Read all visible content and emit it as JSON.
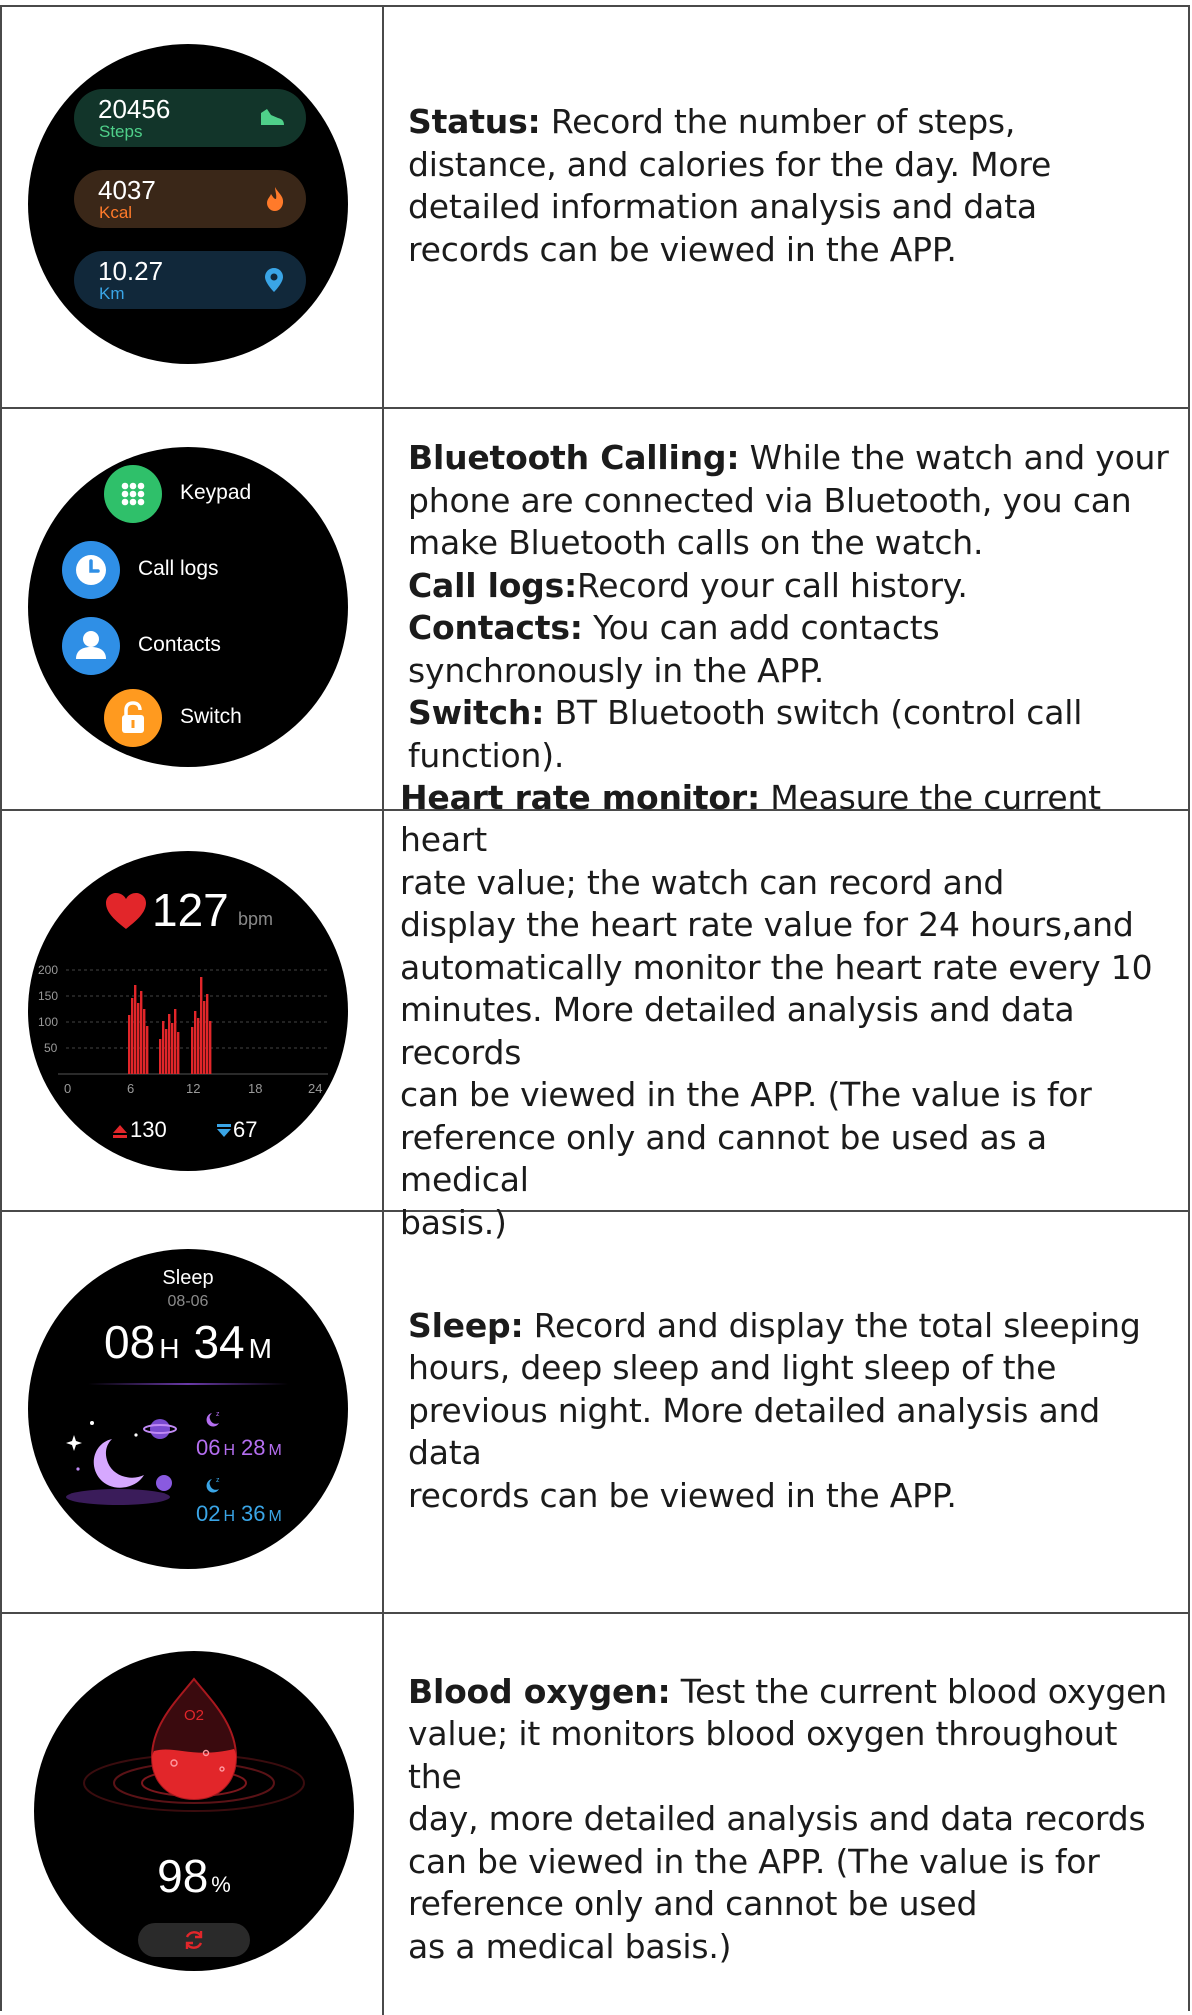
{
  "rows": [
    {
      "watch": {
        "cards": [
          {
            "value": "20456",
            "label": "Steps",
            "icon": "shoe-icon",
            "bg": "#12352a",
            "label_color": "#4fd08a",
            "icon_color": "#4fd08a"
          },
          {
            "value": "4037",
            "label": "Kcal",
            "icon": "flame-icon",
            "bg": "#3a2718",
            "label_color": "#ff7a2a",
            "icon_color": "#ff7a2a"
          },
          {
            "value": "10.27",
            "label": "Km",
            "icon": "location-pin-icon",
            "bg": "#11283a",
            "label_color": "#3aa5e6",
            "icon_color": "#3aa5e6"
          }
        ]
      },
      "desc": [
        {
          "b": "Status:",
          "t": " Record the number of steps,"
        },
        {
          "b": "",
          "t": "distance, and calories for the day. More"
        },
        {
          "b": "",
          "t": "detailed information analysis and data"
        },
        {
          "b": "",
          "t": "records can be viewed in the APP."
        }
      ]
    },
    {
      "watch": {
        "items": [
          {
            "label": "Keypad",
            "icon": "keypad-icon",
            "color": "#2fc06a"
          },
          {
            "label": "Call logs",
            "icon": "clock-icon",
            "color": "#2f8fe6"
          },
          {
            "label": "Contacts",
            "icon": "person-icon",
            "color": "#2f8fe6"
          },
          {
            "label": "Switch",
            "icon": "lock-icon",
            "color": "#ff9a1f"
          }
        ]
      },
      "desc": [
        {
          "b": "Bluetooth Calling:",
          "t": " While the watch and your"
        },
        {
          "b": "",
          "t": "phone are connected via Bluetooth, you can"
        },
        {
          "b": "",
          "t": "make Bluetooth calls on the watch."
        },
        {
          "b": "Call logs:",
          "t": "Record your call history."
        },
        {
          "b": "Contacts:",
          "t": " You can add contacts"
        },
        {
          "b": "",
          "t": "synchronously in the APP."
        },
        {
          "b": "Switch:",
          "t": " BT Bluetooth switch (control call"
        },
        {
          "b": "",
          "t": "function)."
        }
      ]
    },
    {
      "watch": {
        "value": "127",
        "unit": "bpm",
        "y_ticks": [
          "200",
          "150",
          "100",
          "50"
        ],
        "x_ticks": [
          "0",
          "6",
          "12",
          "18",
          "24"
        ],
        "max": "130",
        "min": "67",
        "accent": "#e2262a"
      },
      "desc": [
        {
          "b": "Heart rate monitor:",
          "t": " Measure the current heart"
        },
        {
          "b": "",
          "t": "rate value; the watch can record and"
        },
        {
          "b": "",
          "t": "display the heart rate value for 24 hours,and"
        },
        {
          "b": "",
          "t": "automatically monitor the heart rate every 10"
        },
        {
          "b": "",
          "t": "minutes. More detailed analysis and data records"
        },
        {
          "b": "",
          "t": "can be viewed in the APP. (The value is for"
        },
        {
          "b": "",
          "t": "reference only and cannot be used as a medical"
        },
        {
          "b": "",
          "t": "basis.)"
        }
      ]
    },
    {
      "watch": {
        "title": "Sleep",
        "date": "08-06",
        "hours": "08",
        "h_unit": "H",
        "minutes": "34",
        "m_unit": "M",
        "deep_h": "06",
        "deep_m": "28",
        "light_h": "02",
        "light_m": "36",
        "deep_color": "#b46ef0",
        "light_color": "#3aa5e6"
      },
      "desc": [
        {
          "b": "Sleep:",
          "t": " Record and display the total sleeping"
        },
        {
          "b": "",
          "t": "hours, deep sleep and light sleep of the"
        },
        {
          "b": "",
          "t": "previous night. More detailed analysis and data"
        },
        {
          "b": "",
          "t": "records can be viewed in the APP."
        }
      ]
    },
    {
      "watch": {
        "drop_label": "O2",
        "value": "98",
        "unit": "%",
        "accent": "#e2262a",
        "icon": "refresh-icon"
      },
      "desc": [
        {
          "b": "Blood oxygen:",
          "t": " Test the current blood oxygen"
        },
        {
          "b": "",
          "t": "value; it monitors blood oxygen throughout the"
        },
        {
          "b": "",
          "t": "day, more detailed analysis and data records"
        },
        {
          "b": "",
          "t": "can be viewed in the APP. (The value is for"
        },
        {
          "b": "",
          "t": "reference only and cannot be used"
        },
        {
          "b": "",
          "t": "as a medical basis.)"
        }
      ]
    }
  ]
}
